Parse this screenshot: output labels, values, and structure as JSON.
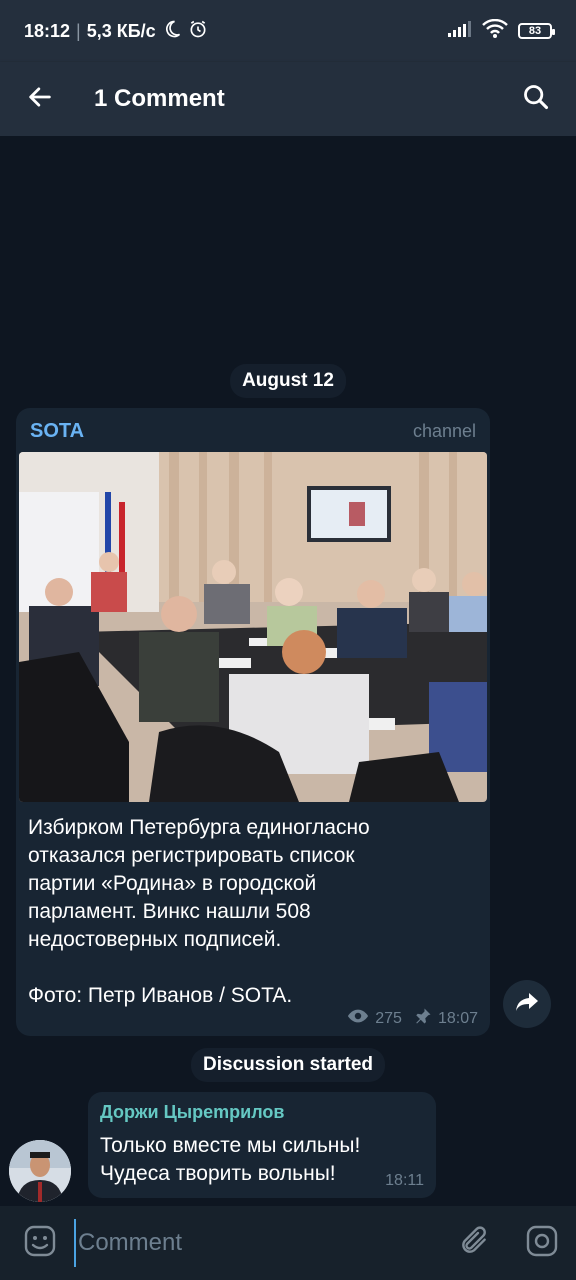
{
  "status_bar": {
    "time": "18:12",
    "network_speed": "5,3 КБ/с",
    "battery": "83",
    "icons": [
      "moon-icon",
      "alarm-icon",
      "signal-icon",
      "wifi-icon",
      "battery-icon"
    ]
  },
  "app_bar": {
    "title": "1 Comment",
    "icons": [
      "back-arrow-icon",
      "search-icon"
    ]
  },
  "chat": {
    "date_separator": "August 12",
    "post": {
      "author": "SOTA",
      "badge": "channel",
      "text_line_1": "Избирком Петербурга единогласно",
      "text_line_2": "отказался регистрировать список",
      "text_line_3": "партии «Родина» в городской",
      "text_line_4": "парламент. Винкс нашли 508",
      "text_line_5": "недостоверных подписей.",
      "photo_credit": "Фото: Петр Иванов / SOTA.",
      "views": "275",
      "time": "18:07"
    },
    "system_message": "Discussion started",
    "comment": {
      "author": "Доржи Цырempилов",
      "line_1": "Только вместе мы сильны!",
      "line_2": "Чудеса творить вольны!",
      "time": "18:11"
    }
  },
  "input_bar": {
    "placeholder": "Comment",
    "icons": [
      "emoji-icon",
      "attach-icon",
      "camera-icon"
    ]
  },
  "colors": {
    "bar": "#242f3d",
    "background": "#0e1621",
    "bubble": "#182533",
    "link": "#6ab3f3",
    "comment_author": "#65c8c3",
    "muted": "#6d7f8f"
  }
}
